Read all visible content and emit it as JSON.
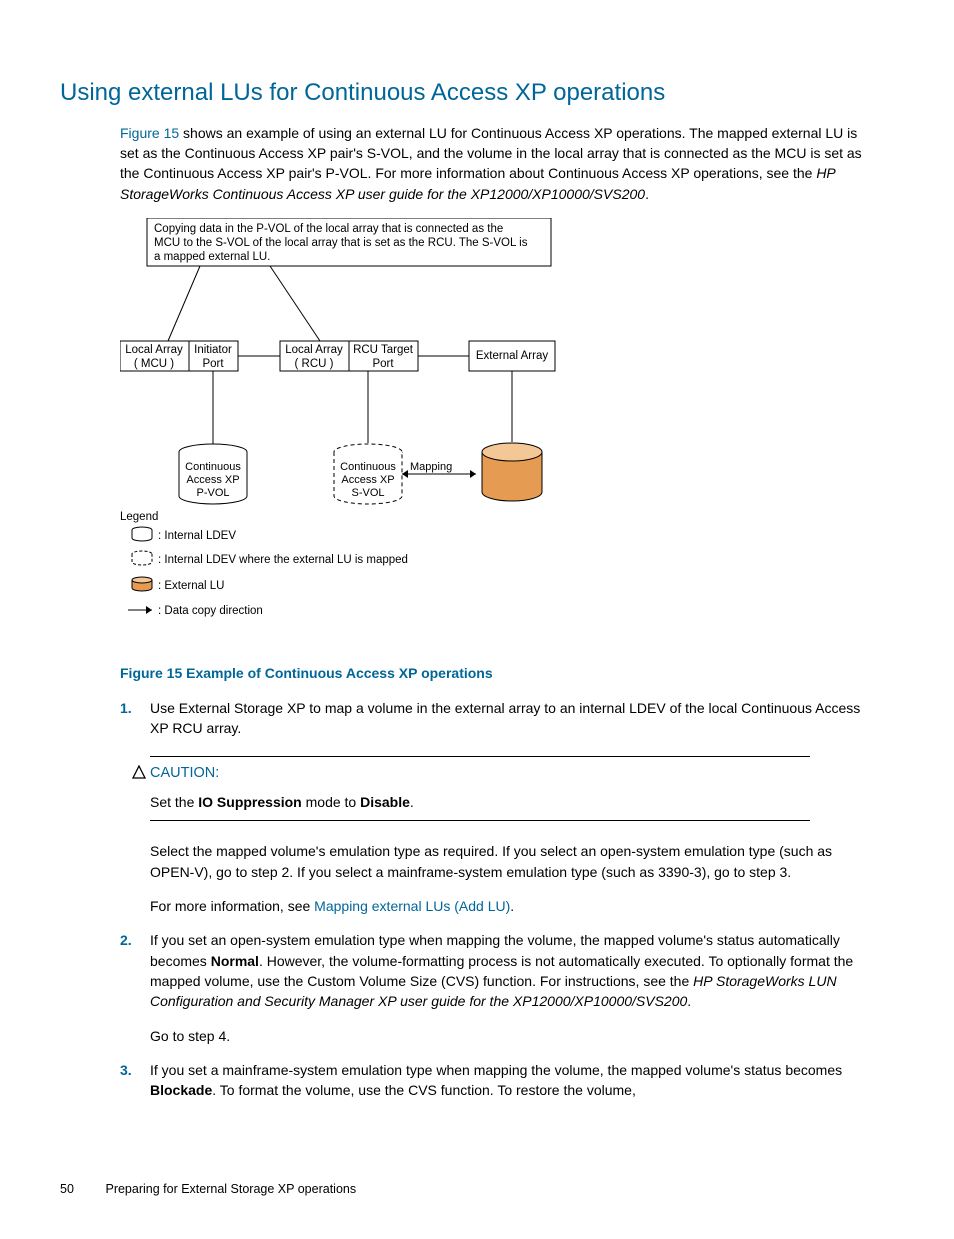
{
  "heading": "Using external LUs for Continuous Access XP operations",
  "intro": {
    "link_figure": "Figure 15",
    "text_after_link": " shows an example of using an external LU for Continuous Access XP operations. The mapped external LU is set as the Continuous Access XP pair's S-VOL, and the volume in the local array that is connected as the MCU is set as the Continuous Access XP pair's P-VOL. For more information about Continuous Access XP operations, see the ",
    "italic_ref": "HP StorageWorks Continuous Access XP user guide for the XP12000/XP10000/SVS200",
    "trailing_period": "."
  },
  "diagram": {
    "callout_l1": "Copying data in the P-VOL of the local array that is connected as the",
    "callout_l2": "MCU to the S-VOL of the local array that is set as the RCU. The S-VOL is",
    "callout_l3": "a mapped external LU.",
    "local_array": "Local Array",
    "mcu": "( MCU )",
    "initiator": "Initiator",
    "port": "Port",
    "rcu": "( RCU )",
    "rcu_target": "RCU Target",
    "external_array": "External Array",
    "ca_xp": "Continuous",
    "ca_xp2": "Access XP",
    "pvol": "P-VOL",
    "svol": "S-VOL",
    "mapping": "Mapping",
    "legend_title": "Legend",
    "legend_internal": ": Internal LDEV",
    "legend_internal_ext": ": Internal LDEV where the external LU is mapped",
    "legend_external": ": External LU",
    "legend_arrow": ": Data copy direction"
  },
  "figure_caption": "Figure 15 Example of Continuous Access XP operations",
  "step1": "Use External Storage XP to map a volume in the external array to an internal LDEV of the local Continuous Access XP RCU array.",
  "caution": {
    "label": "CAUTION:",
    "prefix": "Set the ",
    "b1": "IO Suppression",
    "mid": " mode to ",
    "b2": "Disable",
    "suffix": "."
  },
  "after_caution_p1": "Select the mapped volume's emulation type as required. If you select an open-system emulation type (such as OPEN-V), go to step 2. If you select a mainframe-system emulation type (such as 3390-3), go to step 3.",
  "after_caution_p2_prefix": "For more information, see ",
  "after_caution_p2_link": "Mapping external LUs (Add LU)",
  "after_caution_p2_suffix": ".",
  "step2_a": "If you set an open-system emulation type when mapping the volume, the mapped volume's status automatically becomes ",
  "step2_b": "Normal",
  "step2_c": ". However, the volume-formatting process is not automatically executed. To optionally format the mapped volume, use the Custom Volume Size (CVS) function. For instructions, see the ",
  "step2_italic": "HP StorageWorks LUN Configuration and Security Manager XP user guide for the XP12000/XP10000/SVS200",
  "step2_d": ".",
  "step2_goto": "Go to step 4.",
  "step3_a": "If you set a mainframe-system emulation type when mapping the volume, the mapped volume's status becomes ",
  "step3_b": "Blockade",
  "step3_c": ". To format the volume, use the CVS function. To restore the volume,",
  "footer_page_no": "50",
  "footer_section": "Preparing for External Storage XP operations"
}
